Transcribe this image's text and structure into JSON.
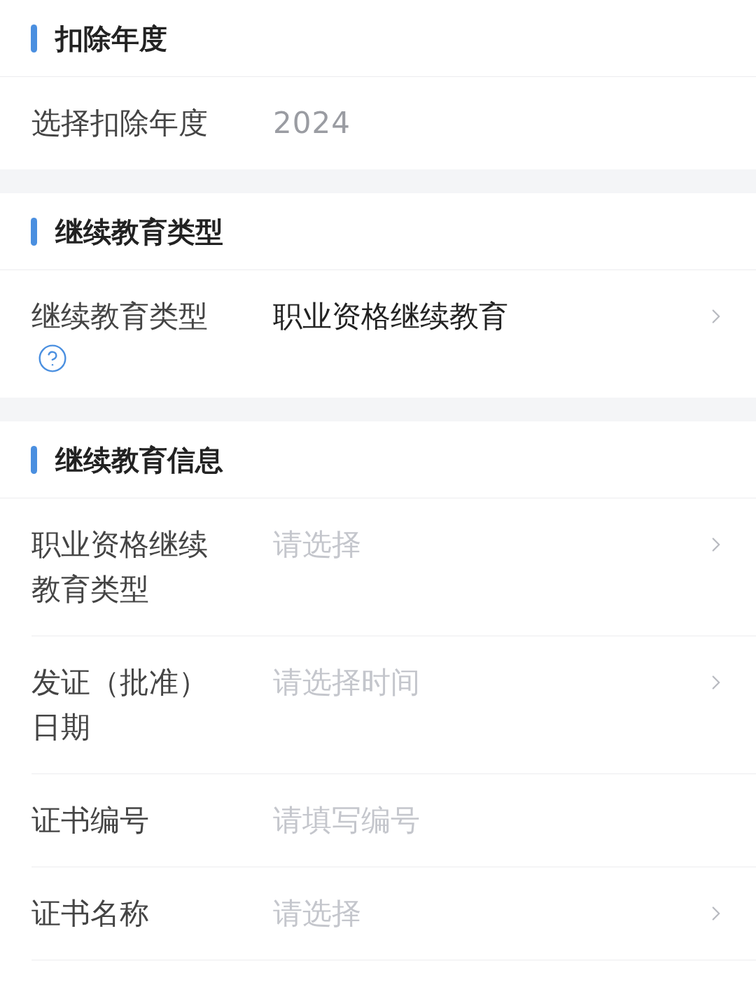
{
  "sections": [
    {
      "title": "扣除年度",
      "rows": [
        {
          "kind": "static",
          "label": "选择扣除年度",
          "value": "2024"
        }
      ]
    },
    {
      "title": "继续教育类型",
      "rows": [
        {
          "kind": "select",
          "label": "继续教育类型",
          "value": "职业资格继续教育",
          "help": true
        }
      ]
    },
    {
      "title": "继续教育信息",
      "rows": [
        {
          "kind": "select",
          "label": "职业资格继续教育类型",
          "placeholder": "请选择"
        },
        {
          "kind": "select",
          "label": "发证（批准）日期",
          "placeholder": "请选择时间"
        },
        {
          "kind": "input",
          "label": "证书编号",
          "placeholder": "请填写编号"
        },
        {
          "kind": "select",
          "label": "证书名称",
          "placeholder": "请选择"
        }
      ]
    }
  ]
}
